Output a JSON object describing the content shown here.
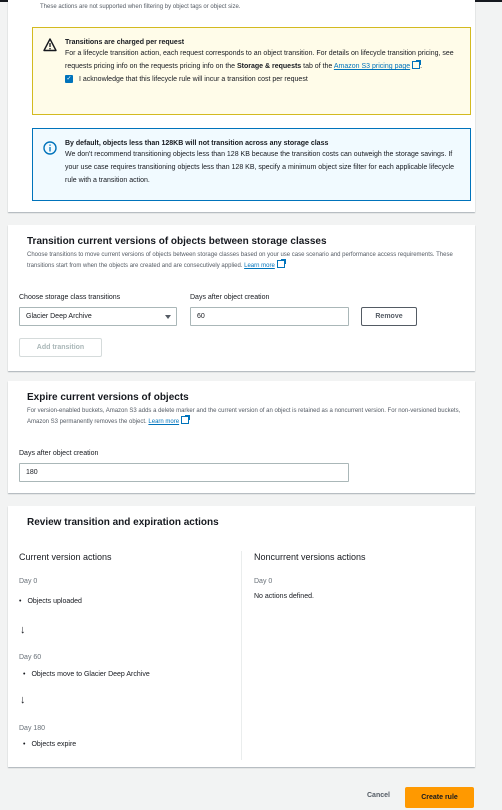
{
  "top_note": "These actions are not supported when filtering by object tags or object size.",
  "warning_alert": {
    "title": "Transitions are charged per request",
    "body_1": "For a lifecycle transition action, each request corresponds to an object transition. For details on lifecycle transition pricing, see requests pricing info on the requests pricing info on the ",
    "body_bold": "Storage & requests",
    "body_2": " tab of the ",
    "link": "Amazon S3 pricing page",
    "ack_label": "I acknowledge that this lifecycle rule will incur a transition cost per request",
    "ack_checked": true
  },
  "info_alert": {
    "title": "By default, objects less than 128KB will not transition across any storage class",
    "body": "We don't recommend transitioning objects less than 128 KB because the transition costs can outweigh the storage savings. If your use case requires transitioning objects less than 128 KB, specify a minimum object size filter for each applicable lifecycle rule with a transition action."
  },
  "transition_section": {
    "title": "Transition current versions of objects between storage classes",
    "description": "Choose transitions to move current versions of objects between storage classes based on your use case scenario and performance access requirements. These transitions start from when the objects are created and are consecutively applied.",
    "learn_more": "Learn more",
    "storage_label": "Choose storage class transitions",
    "storage_value": "Glacier Deep Archive",
    "days_label": "Days after object creation",
    "days_value": "60",
    "remove_button": "Remove",
    "add_button": "Add transition"
  },
  "expire_section": {
    "title": "Expire current versions of objects",
    "description": "For version-enabled buckets, Amazon S3 adds a delete marker and the current version of an object is retained as a noncurrent version. For non-versioned buckets, Amazon S3 permanently removes the object.",
    "learn_more": "Learn more",
    "days_label": "Days after object creation",
    "days_value": "180"
  },
  "review_section": {
    "title": "Review transition and expiration actions",
    "current_heading": "Current version actions",
    "noncurrent_heading": "Noncurrent versions actions",
    "current_steps": [
      {
        "day": "Day 0",
        "action": "Objects uploaded"
      },
      {
        "day": "Day 60",
        "action": "Objects move to Glacier Deep Archive"
      },
      {
        "day": "Day 180",
        "action": "Objects expire"
      }
    ],
    "noncurrent_day": "Day 0",
    "noncurrent_action": "No actions defined."
  },
  "footer": {
    "cancel": "Cancel",
    "create": "Create rule"
  },
  "colors": {
    "accent": "#0073bb",
    "primary_button": "#ff9900",
    "warning_bg": "#fffce9",
    "info_bg": "#f1faff"
  }
}
